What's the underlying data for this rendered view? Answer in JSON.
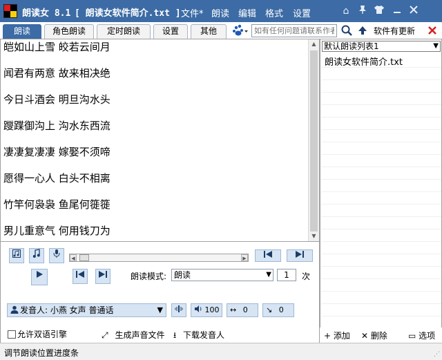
{
  "titlebar": {
    "app_name": "朗读女 8.1",
    "doc_title": "[ 朗读女软件简介.txt ]",
    "menus": [
      "文件*",
      "朗读",
      "编辑",
      "格式",
      "设置"
    ],
    "icons": [
      "home-icon",
      "shirt-icon",
      "minimize-icon",
      "close-icon"
    ]
  },
  "tabs": {
    "items": [
      "朗读",
      "角色朗读",
      "定时朗读",
      "设置",
      "其他"
    ],
    "active": "朗读"
  },
  "search": {
    "placeholder": "如有任何问题请联系作者"
  },
  "update_label": "软件有更新",
  "text_content": {
    "lines": [
      "皑如山上雪  皎若云间月",
      "闻君有两意  故来相决绝",
      "今日斗酒会  明旦沟水头",
      "躞蹀御沟上  沟水东西流",
      "凄凄复凄凄  嫁娶不须啼",
      "愿得一心人  白头不相离",
      "竹竿何袅袅  鱼尾何簁簁",
      "男儿重意气  何用钱刀为"
    ]
  },
  "playlist": {
    "selected_list": "默认朗读列表1",
    "items": [
      "朗读女软件简介.txt"
    ]
  },
  "controls": {
    "mode_label": "朗读模式:",
    "mode_value": "朗读",
    "repeat_count": "1",
    "repeat_unit": "次",
    "voice": "发音人: 小燕 女声 普通话",
    "volume": "100",
    "speed": "0",
    "pitch": "0",
    "dual_engine_label": "允许双语引擎",
    "dual_engine_checked": false,
    "generate_audio_label": "生成声音文件",
    "download_voice_label": "下载发音人"
  },
  "list_actions": {
    "add": "添加",
    "delete": "删除",
    "options": "选项"
  },
  "status": {
    "text": "调节朗读位置进度条"
  },
  "colors": {
    "titlebar": "#3c6ba5",
    "button_bg": "#d6e4f4",
    "button_border": "#9fb7d4"
  }
}
